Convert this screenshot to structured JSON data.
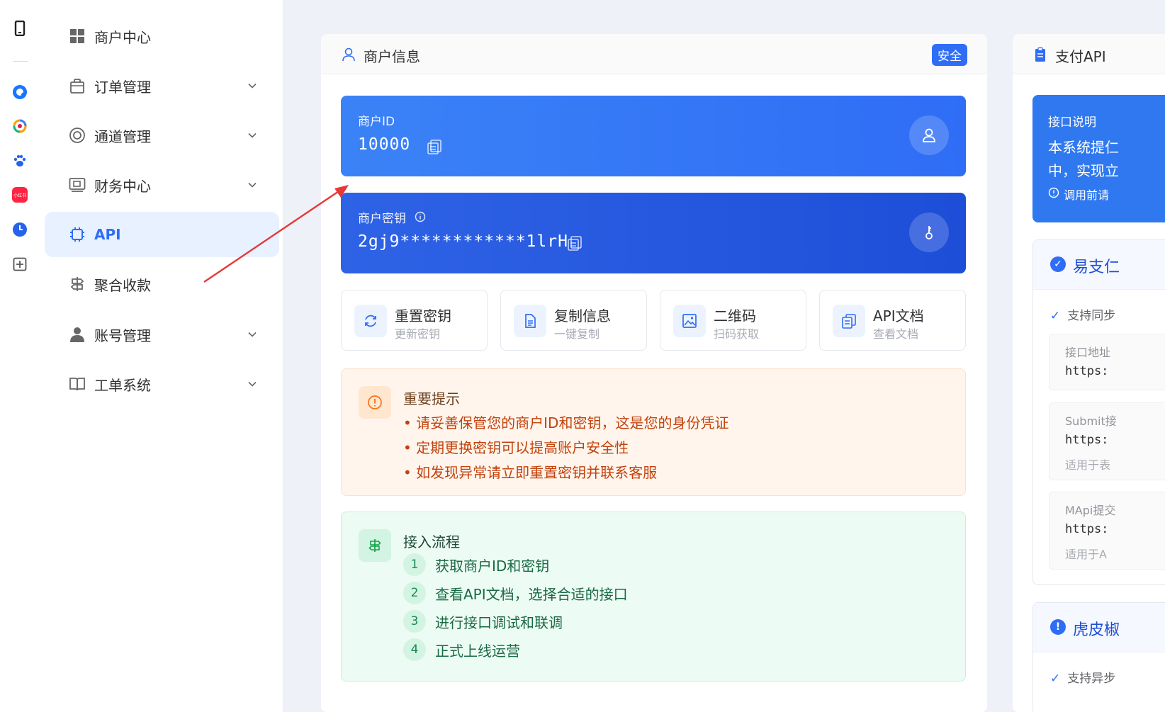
{
  "sidebar": {
    "items": [
      {
        "label": "商户中心",
        "icon": "grid-icon",
        "expandable": false,
        "active": false
      },
      {
        "label": "订单管理",
        "icon": "bag-icon",
        "expandable": true,
        "active": false
      },
      {
        "label": "通道管理",
        "icon": "lifebuoy-icon",
        "expandable": true,
        "active": false
      },
      {
        "label": "财务中心",
        "icon": "wallet-icon",
        "expandable": true,
        "active": false
      },
      {
        "label": "API",
        "icon": "chip-icon",
        "expandable": false,
        "active": true
      },
      {
        "label": "聚合收款",
        "icon": "signpost-icon",
        "expandable": false,
        "active": false
      },
      {
        "label": "账号管理",
        "icon": "user-icon",
        "expandable": true,
        "active": false
      },
      {
        "label": "工单系统",
        "icon": "book-icon",
        "expandable": true,
        "active": false
      }
    ]
  },
  "rail": {
    "icons": [
      "phone-icon",
      "q-app-icon",
      "color-ring-app-icon",
      "paw-app-icon",
      "xiaohongshu-app-icon",
      "clock-app-icon",
      "plus-square-icon"
    ],
    "xiaohongshu_text": "小红书"
  },
  "merchant": {
    "title": "商户信息",
    "badge": "安全",
    "id_label": "商户ID",
    "id_value": "10000",
    "key_label": "商户密钥",
    "key_value": "2gj9************1lrH",
    "actions": [
      {
        "title": "重置密钥",
        "subtitle": "更新密钥",
        "icon": "refresh-icon"
      },
      {
        "title": "复制信息",
        "subtitle": "一键复制",
        "icon": "document-icon"
      },
      {
        "title": "二维码",
        "subtitle": "扫码获取",
        "icon": "image-icon"
      },
      {
        "title": "API文档",
        "subtitle": "查看文档",
        "icon": "copy-doc-icon"
      }
    ],
    "notice": {
      "title": "重要提示",
      "lines": [
        "• 请妥善保管您的商户ID和密钥，这是您的身份凭证",
        "• 定期更换密钥可以提高账户安全性",
        "• 如发现异常请立即重置密钥并联系客服"
      ]
    },
    "flow": {
      "title": "接入流程",
      "steps": [
        {
          "n": "1",
          "text": "获取商户ID和密钥"
        },
        {
          "n": "2",
          "text": "查看API文档，选择合适的接口"
        },
        {
          "n": "3",
          "text": "进行接口调试和联调"
        },
        {
          "n": "4",
          "text": "正式上线运营"
        }
      ]
    }
  },
  "api_panel": {
    "title": "支付API",
    "intro_label": "接口说明",
    "intro_line1": "本系统提仁",
    "intro_line2": "中，实现立",
    "intro_note": "调用前请",
    "yipay": {
      "title": "易支仁",
      "check": "支持同步",
      "endpoints": [
        {
          "label": "接口地址",
          "url": "https:",
          "desc": ""
        },
        {
          "label": "Submit接",
          "url": "https:",
          "desc": "适用于表"
        },
        {
          "label": "MApi提交",
          "url": "https:",
          "desc": "适用于A"
        }
      ]
    },
    "hupi": {
      "title": "虎皮椒",
      "check": "支持异步"
    }
  },
  "colors": {
    "primary": "#2f6df6",
    "id_gradient": [
      "#3b82f6",
      "#2f6df6"
    ],
    "key_gradient": [
      "#2f63e6",
      "#1d4ed8"
    ],
    "notice_bg": "#fff5ec",
    "notice_text": "#c2410c",
    "flow_bg": "#ecfbf3",
    "flow_text": "#1a6a45",
    "arrow": "#e53935"
  }
}
